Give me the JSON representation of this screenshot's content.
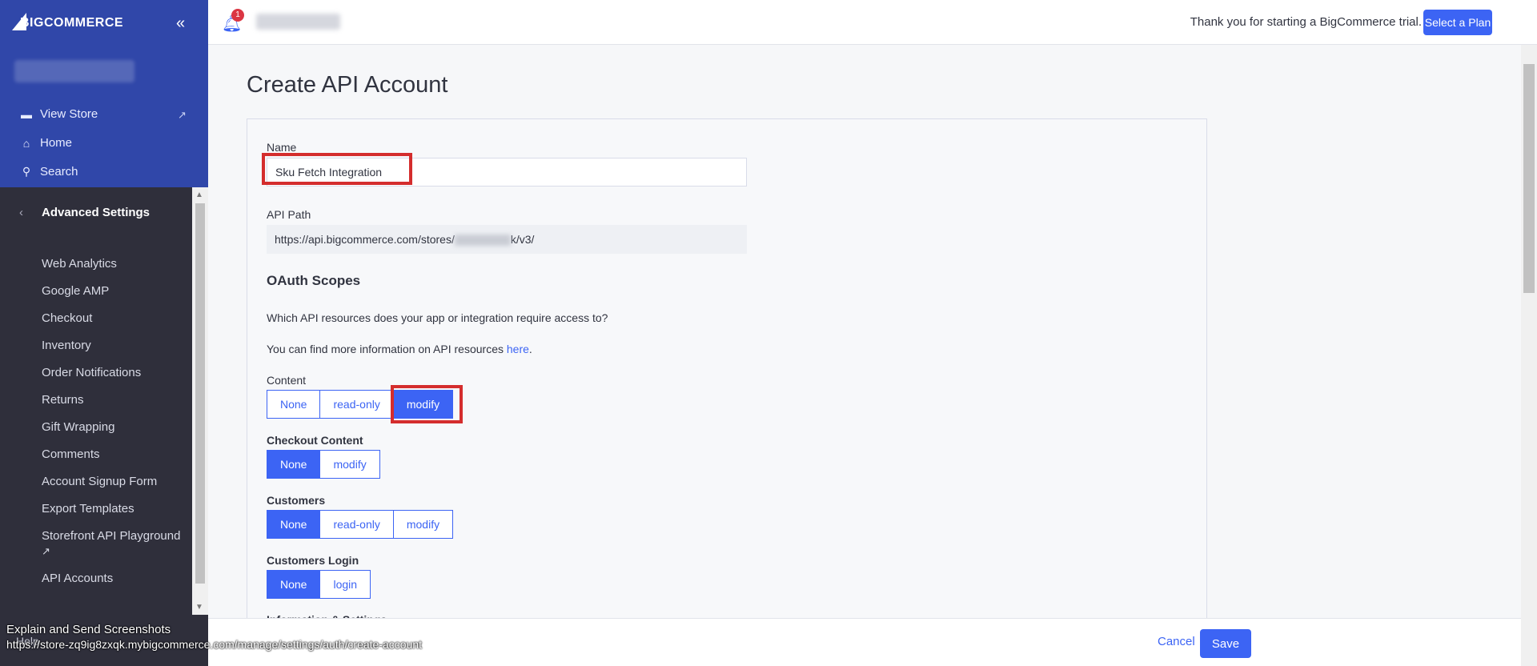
{
  "sidebar": {
    "brand": "BIGCOMMERCE",
    "collapse_icon": "«",
    "nav": [
      {
        "label": "View Store",
        "icon": "store-icon"
      },
      {
        "label": "Home",
        "icon": "home-icon"
      },
      {
        "label": "Search",
        "icon": "search-icon"
      }
    ],
    "section_title": "Advanced Settings",
    "items": [
      {
        "label": "Web Analytics"
      },
      {
        "label": "Google AMP"
      },
      {
        "label": "Checkout"
      },
      {
        "label": "Inventory"
      },
      {
        "label": "Order Notifications"
      },
      {
        "label": "Returns"
      },
      {
        "label": "Gift Wrapping"
      },
      {
        "label": "Comments"
      },
      {
        "label": "Account Signup Form"
      },
      {
        "label": "Export Templates"
      },
      {
        "label": "Storefront API Playground"
      },
      {
        "label": "API Accounts"
      }
    ],
    "help": "Help"
  },
  "topbar": {
    "notification_count": "1",
    "trial_message": "Thank you for starting a BigCommerce trial.",
    "select_plan": "Select a Plan"
  },
  "page": {
    "title": "Create API Account"
  },
  "form": {
    "name_label": "Name",
    "name_value": "Sku Fetch Integration",
    "api_path_label": "API Path",
    "api_path_prefix": "https://api.bigcommerce.com/stores/",
    "api_path_suffix": "k/v3/",
    "oauth_title": "OAuth Scopes",
    "oauth_question": "Which API resources does your app or integration require access to?",
    "oauth_info_prefix": "You can find more information on API resources ",
    "oauth_info_link": "here",
    "oauth_info_suffix": ".",
    "scopes": [
      {
        "label": "Content",
        "options": [
          "None",
          "read-only",
          "modify"
        ],
        "selected": "modify"
      },
      {
        "label": "Checkout Content",
        "options": [
          "None",
          "modify"
        ],
        "selected": "None"
      },
      {
        "label": "Customers",
        "options": [
          "None",
          "read-only",
          "modify"
        ],
        "selected": "None"
      },
      {
        "label": "Customers Login",
        "options": [
          "None",
          "login"
        ],
        "selected": "None"
      }
    ],
    "next_scope_partial": "Information & Settings"
  },
  "actions": {
    "cancel": "Cancel",
    "save": "Save"
  },
  "overlay": {
    "title": "Explain and Send Screenshots",
    "url": "https://store-zq9ig8zxqk.mybigcommerce.com/manage/settings/auth/create-account"
  },
  "colors": {
    "primary": "#3c64f4",
    "sidebar_top": "#3047a9",
    "sidebar_dark": "#2f2f3b",
    "highlight": "#d42d2d"
  }
}
